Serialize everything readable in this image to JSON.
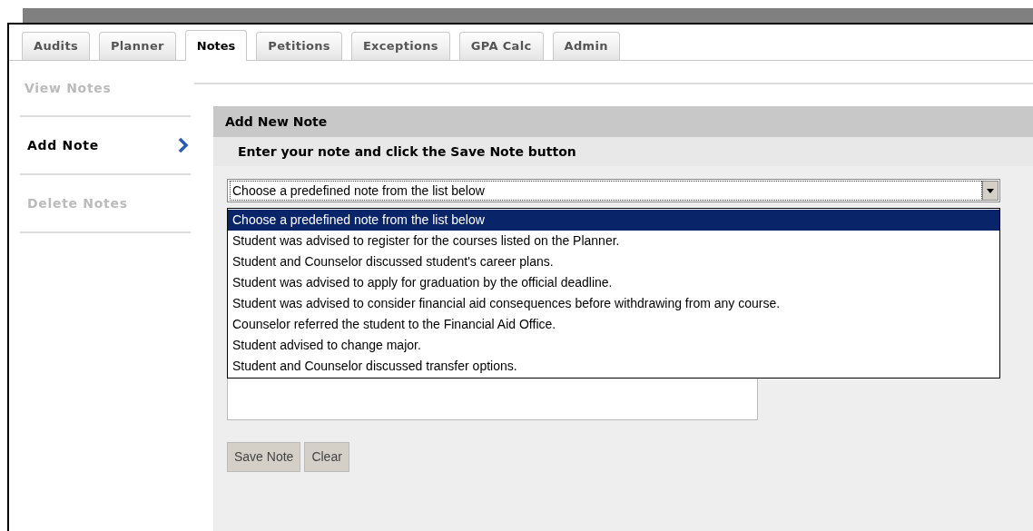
{
  "tabs": [
    {
      "label": "Audits",
      "selected": false
    },
    {
      "label": "Planner",
      "selected": false
    },
    {
      "label": "Notes",
      "selected": true
    },
    {
      "label": "Petitions",
      "selected": false
    },
    {
      "label": "Exceptions",
      "selected": false
    },
    {
      "label": "GPA Calc",
      "selected": false
    },
    {
      "label": "Admin",
      "selected": false
    }
  ],
  "sidebar": {
    "items": [
      {
        "label": "View Notes",
        "selected": false
      },
      {
        "label": "Add Note",
        "selected": true
      },
      {
        "label": "Delete Notes",
        "selected": false
      }
    ]
  },
  "panel": {
    "title": "Add New Note",
    "instruction": "Enter your note and click the Save Note button",
    "select": {
      "value": "Choose a predefined note from the list below",
      "expanded": true,
      "options": [
        {
          "label": "Choose a predefined note from the list below",
          "selected": true
        },
        {
          "label": "Student was advised to register for the courses listed on the Planner.",
          "selected": false
        },
        {
          "label": "Student and Counselor discussed student's career plans.",
          "selected": false
        },
        {
          "label": "Student was advised to apply for graduation by the official deadline.",
          "selected": false
        },
        {
          "label": "Student was advised to consider financial aid consequences before withdrawing from any course.",
          "selected": false
        },
        {
          "label": "Counselor referred the student to the Financial Aid Office.",
          "selected": false
        },
        {
          "label": "Student advised to change major.",
          "selected": false
        },
        {
          "label": "Student and Counselor discussed transfer options.",
          "selected": false
        }
      ]
    },
    "buttons": [
      "Save Note",
      "Clear"
    ]
  }
}
